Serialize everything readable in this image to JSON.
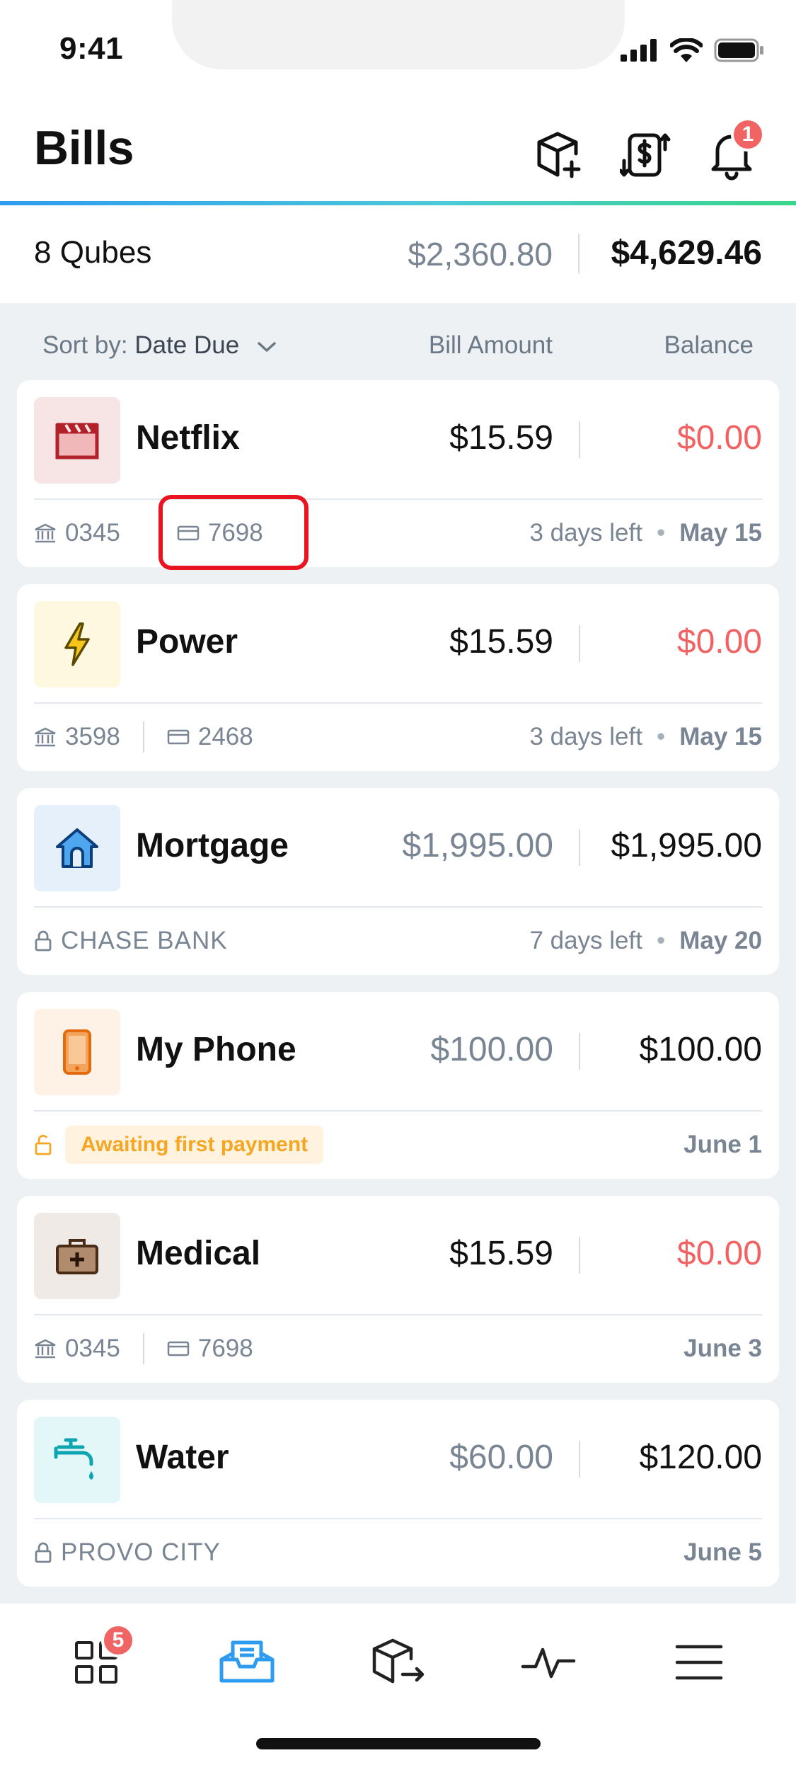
{
  "status_bar": {
    "time": "9:41"
  },
  "header": {
    "title": "Bills",
    "notification_count": "1"
  },
  "summary": {
    "qubes": "8 Qubes",
    "bill_total": "$2,360.80",
    "balance_total": "$4,629.46"
  },
  "sort": {
    "prefix": "Sort by:",
    "value": "Date Due",
    "col_bill": "Bill Amount",
    "col_balance": "Balance"
  },
  "bills": [
    {
      "name": "Netflix",
      "amount": "$15.59",
      "balance": "$0.00",
      "bank": "0345",
      "card": "7698",
      "days_left": "3 days left",
      "due": "May 15"
    },
    {
      "name": "Power",
      "amount": "$15.59",
      "balance": "$0.00",
      "bank": "3598",
      "card": "2468",
      "days_left": "3 days left",
      "due": "May 15"
    },
    {
      "name": "Mortgage",
      "amount": "$1,995.00",
      "balance": "$1,995.00",
      "source": "CHASE BANK",
      "days_left": "7 days left",
      "due": "May 20"
    },
    {
      "name": "My Phone",
      "amount": "$100.00",
      "balance": "$100.00",
      "status": "Awaiting first payment",
      "due": "June 1"
    },
    {
      "name": "Medical",
      "amount": "$15.59",
      "balance": "$0.00",
      "bank": "0345",
      "card": "7698",
      "due": "June 3"
    },
    {
      "name": "Water",
      "amount": "$60.00",
      "balance": "$120.00",
      "source": "PROVO CITY",
      "due": "June 5"
    }
  ],
  "bottom_nav": {
    "dashboard_badge": "5"
  },
  "icons": {
    "netflix": "clapperboard-icon",
    "power": "lightning-icon",
    "mortgage": "house-icon",
    "phone": "smartphone-icon",
    "medical": "medical-kit-icon",
    "water": "faucet-icon"
  },
  "colors": {
    "accent": "#2d9cf0",
    "negative": "#f26262",
    "warning": "#f5a623",
    "badge": "#f06464"
  }
}
